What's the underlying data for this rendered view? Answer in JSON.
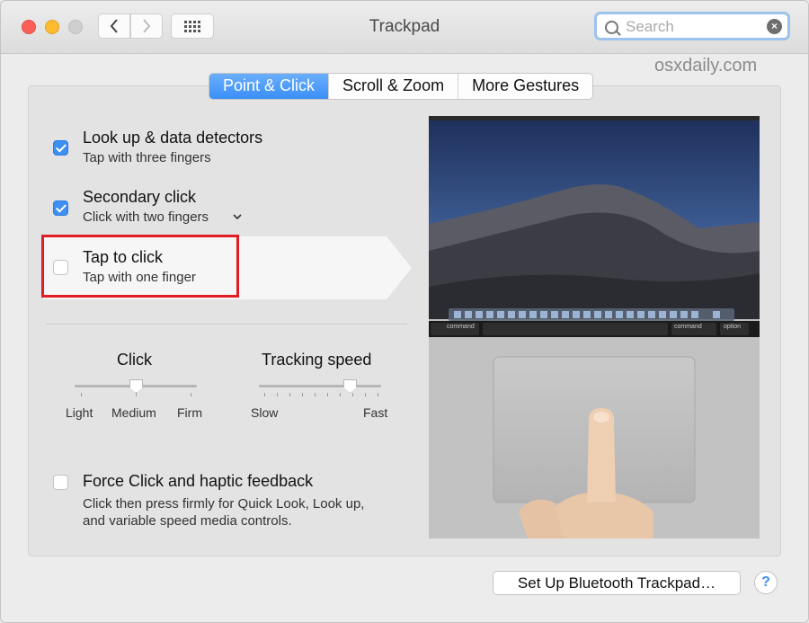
{
  "window": {
    "title": "Trackpad"
  },
  "search": {
    "placeholder": "Search"
  },
  "watermark": "osxdaily.com",
  "tabs": [
    {
      "label": "Point & Click",
      "active": true
    },
    {
      "label": "Scroll & Zoom",
      "active": false
    },
    {
      "label": "More Gestures",
      "active": false
    }
  ],
  "options": [
    {
      "title": "Look up & data detectors",
      "subtitle": "Tap with three fingers",
      "checked": true
    },
    {
      "title": "Secondary click",
      "subtitle": "Click with two fingers",
      "checked": true
    },
    {
      "title": "Tap to click",
      "subtitle": "Tap with one finger",
      "checked": false
    }
  ],
  "sliders": {
    "click": {
      "title": "Click",
      "labels": [
        "Light",
        "Medium",
        "Firm"
      ],
      "value_label": "Medium"
    },
    "tracking": {
      "title": "Tracking speed",
      "min_label": "Slow",
      "max_label": "Fast",
      "level": 0.8
    }
  },
  "force_click": {
    "title": "Force Click and haptic feedback",
    "desc_line1": "Click then press firmly for Quick Look, Look up,",
    "desc_line2": "and variable speed media controls.",
    "checked": false
  },
  "keyboard": {
    "key_left": "command",
    "key_right1": "command",
    "key_right2": "option"
  },
  "buttons": {
    "setup_bluetooth": "Set Up Bluetooth Trackpad…",
    "help": "?"
  },
  "colors": {
    "accent": "#3d8ff2",
    "highlight": "#e01e24"
  }
}
